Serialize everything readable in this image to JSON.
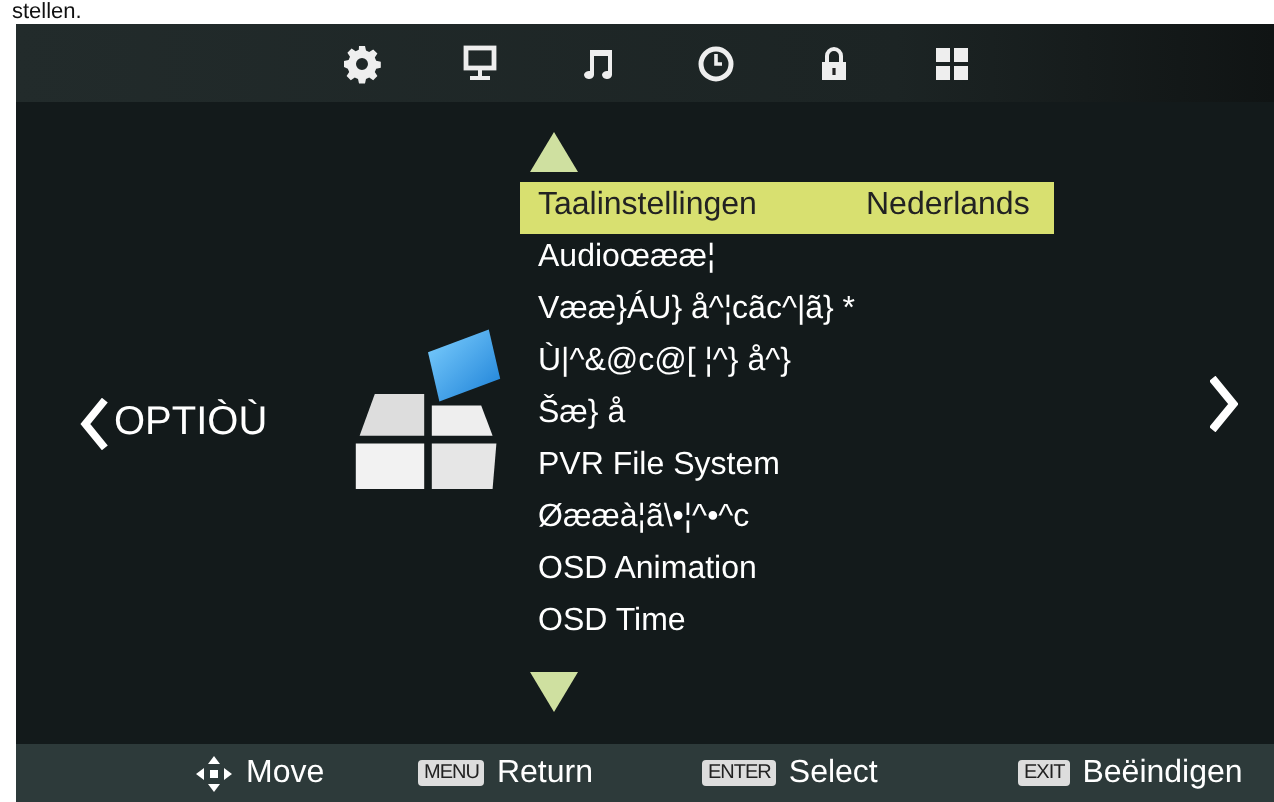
{
  "page_caption": "stellen.",
  "top_icons": [
    {
      "kind": "gear"
    },
    {
      "kind": "monitor"
    },
    {
      "kind": "music"
    },
    {
      "kind": "clock"
    },
    {
      "kind": "lock"
    },
    {
      "kind": "grid"
    }
  ],
  "section_title": "OPTIÒÙ",
  "menu": [
    {
      "label": "Taalinstellingen",
      "value": "Nederlands",
      "selected": true
    },
    {
      "label": "Audioœææ¦",
      "selected": false
    },
    {
      "label": "Vææ}ÁU} å^¦cãc^|ã} *",
      "selected": false
    },
    {
      "label": "Ù|^&@c@[ ¦^} å^}",
      "selected": false
    },
    {
      "label": "Šæ} å",
      "selected": false
    },
    {
      "label": "PVR File System",
      "selected": false
    },
    {
      "label": "Øææà¦ã\\•¦^•^c",
      "selected": false
    },
    {
      "label": "OSD Animation",
      "selected": false
    },
    {
      "label": "OSD Time",
      "selected": false
    }
  ],
  "footer": [
    {
      "kind": "move",
      "label": "Move"
    },
    {
      "kind": "key",
      "key": "MENU",
      "label": "Return"
    },
    {
      "kind": "key",
      "key": "ENTER",
      "label": "Select"
    },
    {
      "kind": "key",
      "key": "EXIT",
      "label": "Beëindigen"
    }
  ]
}
